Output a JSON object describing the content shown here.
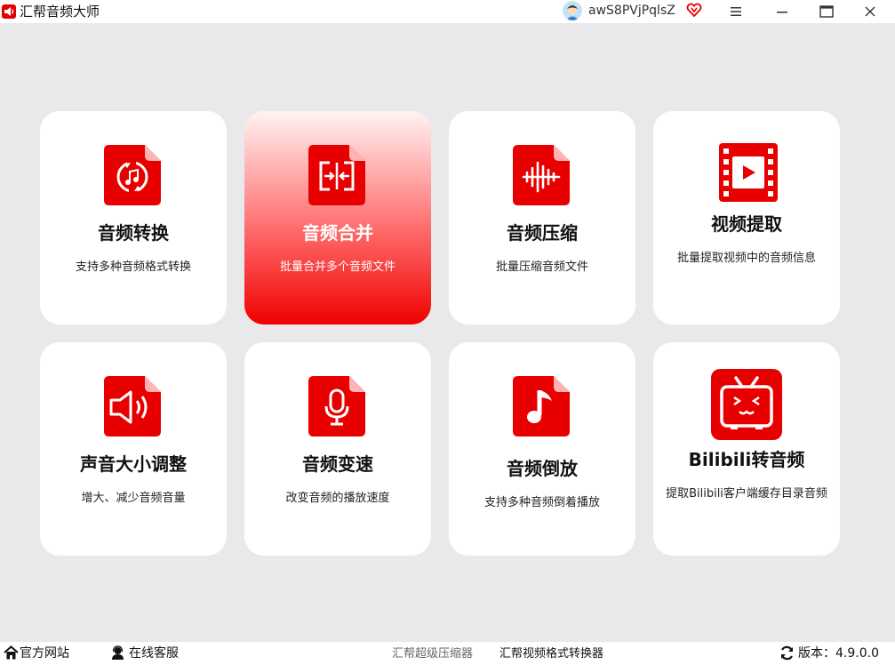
{
  "window": {
    "title": "汇帮音频大师",
    "username": "awS8PVjPqlsZ",
    "controls": [
      "menu-icon",
      "minimize-icon",
      "maximize-icon",
      "close-icon"
    ]
  },
  "theme": {
    "accent": "#f00000",
    "background": "#e9e9ec",
    "card": "#ffffff"
  },
  "cards": [
    {
      "title": "音频转换",
      "desc": "支持多种音频格式转换",
      "icon": "audio-convert-icon"
    },
    {
      "title": "音频合并",
      "desc": "批量合并多个音频文件",
      "icon": "audio-merge-icon",
      "active": true
    },
    {
      "title": "音频压缩",
      "desc": "批量压缩音频文件",
      "icon": "audio-compress-icon"
    },
    {
      "title": "视频提取",
      "desc": "批量提取视频中的音频信息",
      "icon": "video-extract-icon"
    },
    {
      "title": "声音大小调整",
      "desc": "增大、减少音频音量",
      "icon": "volume-icon"
    },
    {
      "title": "音频变速",
      "desc": "改变音频的播放速度",
      "icon": "microphone-icon"
    },
    {
      "title": "音频倒放",
      "desc": "支持多种音频倒着播放",
      "icon": "music-note-icon"
    },
    {
      "title": "Bilibili转音频",
      "desc": "提取Bilibili客户端缓存目录音频",
      "icon": "bilibili-tv-icon"
    }
  ],
  "statusbar": {
    "website": "官方网站",
    "support": "在线客服",
    "compressor_link": "汇帮超级压缩器",
    "converter_link": "汇帮视频格式转换器",
    "version_label": "版本：",
    "version": "4.9.0.0"
  }
}
